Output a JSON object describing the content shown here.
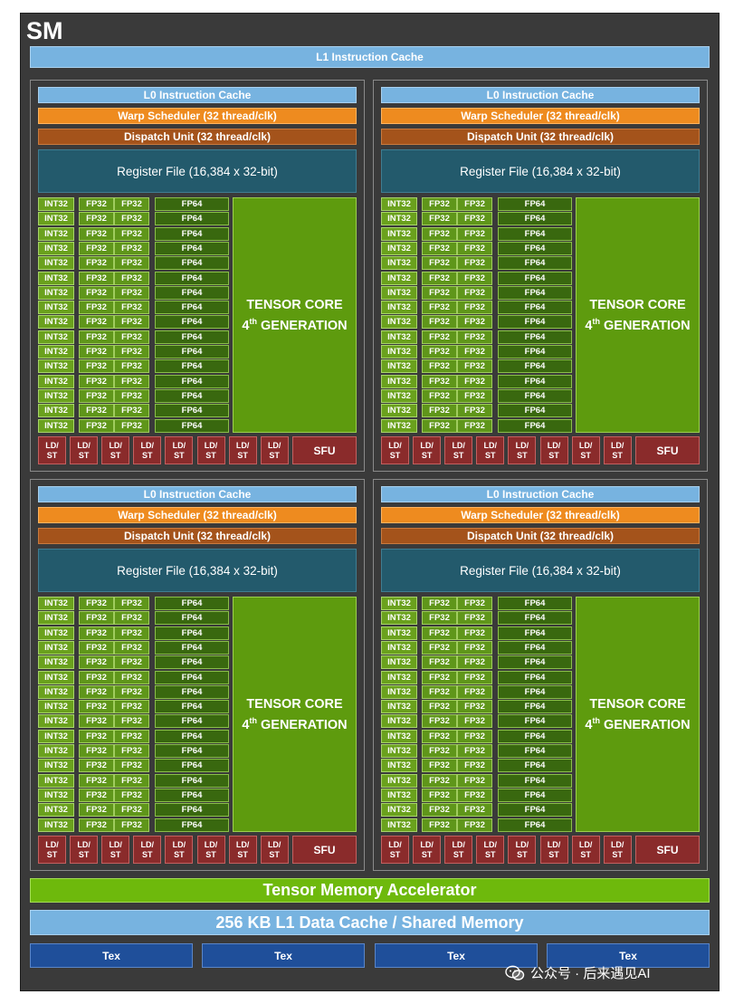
{
  "sm": {
    "title": "SM",
    "l1_instruction_cache": "L1 Instruction Cache",
    "tensor_memory_accelerator": "Tensor Memory Accelerator",
    "l1_data_cache": "256 KB L1 Data Cache / Shared Memory",
    "tex_units": [
      "Tex",
      "Tex",
      "Tex",
      "Tex"
    ]
  },
  "quadrant": {
    "l0_cache": "L0 Instruction Cache",
    "warp_scheduler": "Warp Scheduler (32 thread/clk)",
    "dispatch_unit": "Dispatch Unit (32 thread/clk)",
    "register_file": "Register File (16,384 x 32-bit)",
    "int32_label": "INT32",
    "fp32_label": "FP32",
    "fp64_label": "FP64",
    "rows": 16,
    "tensor_line1": "TENSOR CORE",
    "tensor_gen_number": "4",
    "tensor_gen_suffix": "th",
    "tensor_gen_word": "GENERATION",
    "ldst_top": "LD/",
    "ldst_bottom": "ST",
    "ldst_count": 8,
    "sfu": "SFU"
  },
  "quadrant_count": 4,
  "watermark": "公众号 · 后来遇见AI",
  "icons": {
    "watermark_icon": "wechat-icon"
  },
  "colors": {
    "sm_background": "#3a3a3a",
    "cache_blue": "#77b3e0",
    "warp_orange": "#ee8b1f",
    "dispatch_brown": "#a4531b",
    "register_teal": "#235a6c",
    "core_green": "#6aa11d",
    "tensor_green": "#5e9b0e",
    "ldst_red": "#8a2b2b",
    "tex_blue": "#1f4f9a"
  }
}
